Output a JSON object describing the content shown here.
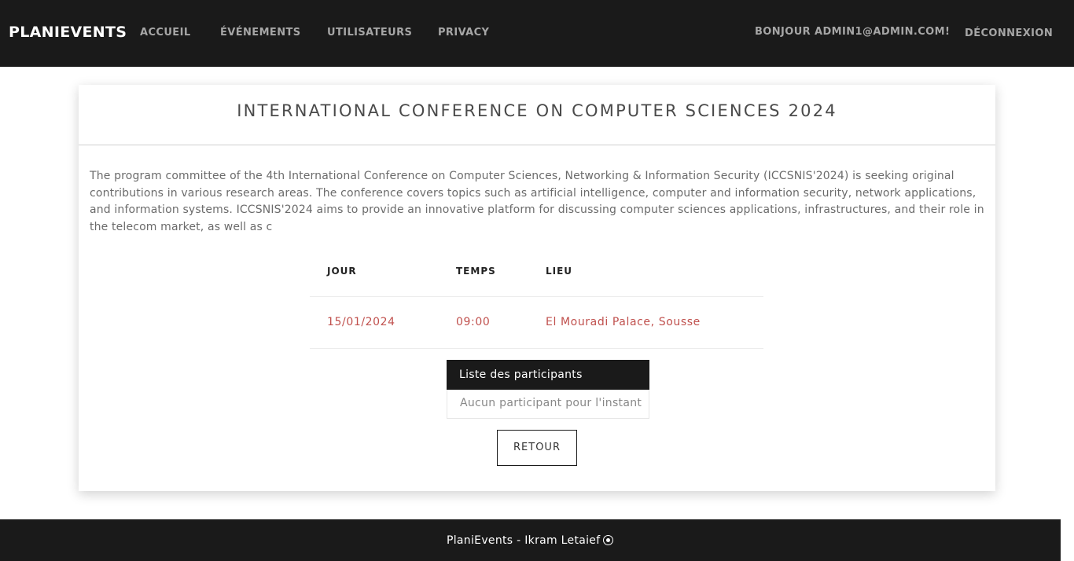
{
  "nav": {
    "brand": "PLANIEVENTS",
    "links": [
      "ACCUEIL",
      "ÉVÉNEMENTS",
      "UTILISATEURS",
      "PRIVACY"
    ],
    "greeting": "BONJOUR ADMIN1@ADMIN.COM!",
    "logout": "DÉCONNEXION"
  },
  "event": {
    "title": "INTERNATIONAL CONFERENCE ON COMPUTER SCIENCES 2024",
    "description": "The program committee of the 4th International Conference on Computer Sciences, Networking & Information Security (ICCSNIS'2024) is seeking original contributions in various research areas. The conference covers topics such as artificial intelligence, computer and information security, network applications, and information systems. ICCSNIS'2024 aims to provide an innovative platform for discussing computer sciences applications, infrastructures, and their role in the telecom market, as well as c",
    "table": {
      "headers": [
        "JOUR",
        "TEMPS",
        "LIEU"
      ],
      "row": [
        "15/01/2024",
        "09:00",
        "El Mouradi Palace, Sousse"
      ]
    },
    "participants": {
      "header": "Liste des participants",
      "empty": "Aucun participant pour l'instant"
    },
    "back_button": "RETOUR"
  },
  "footer": {
    "text": "PlaniEvents - Ikram Letaief",
    "icon": "copyright-icon"
  },
  "colors": {
    "dark": "#1a1a1a",
    "accent": "#c0504d"
  }
}
